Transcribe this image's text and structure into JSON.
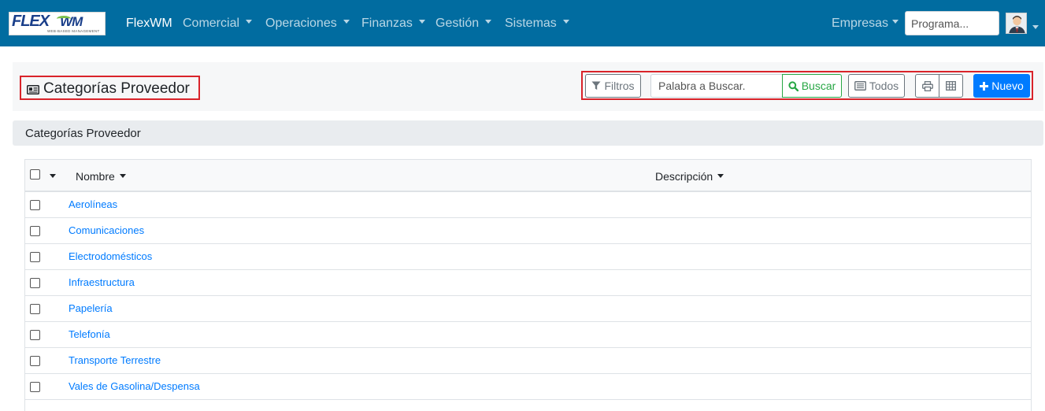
{
  "colors": {
    "navbar": "#016ca0",
    "accent": "#007bff",
    "success": "#28a745",
    "highlight_border": "#d9232a"
  },
  "navbar": {
    "logo": {
      "word_flex": "FLEX",
      "word_wm": "WM",
      "tagline": "WEB-BASED MANAGEMENT"
    },
    "brand": "FlexWM",
    "menus": [
      "Comercial",
      "Operaciones",
      "Finanzas",
      "Gestión",
      "Sistemas"
    ],
    "companies_label": "Empresas",
    "program_placeholder": "Programa..."
  },
  "header": {
    "title": "Categorías Proveedor",
    "title_icon": "id-card-icon",
    "filters_label": "Filtros",
    "search_placeholder": "Palabra a Buscar.",
    "search_button": "Buscar",
    "all_button": "Todos",
    "new_button": "Nuevo"
  },
  "section": {
    "title": "Categorías Proveedor"
  },
  "table": {
    "columns": [
      "Nombre",
      "Descripción"
    ],
    "rows": [
      {
        "name": "Aerolíneas",
        "description": ""
      },
      {
        "name": "Comunicaciones",
        "description": ""
      },
      {
        "name": "Electrodomésticos",
        "description": ""
      },
      {
        "name": "Infraestructura",
        "description": ""
      },
      {
        "name": "Papelería",
        "description": ""
      },
      {
        "name": "Telefonía",
        "description": ""
      },
      {
        "name": "Transporte Terrestre",
        "description": ""
      },
      {
        "name": "Vales de Gasolina/Despensa",
        "description": ""
      }
    ]
  }
}
